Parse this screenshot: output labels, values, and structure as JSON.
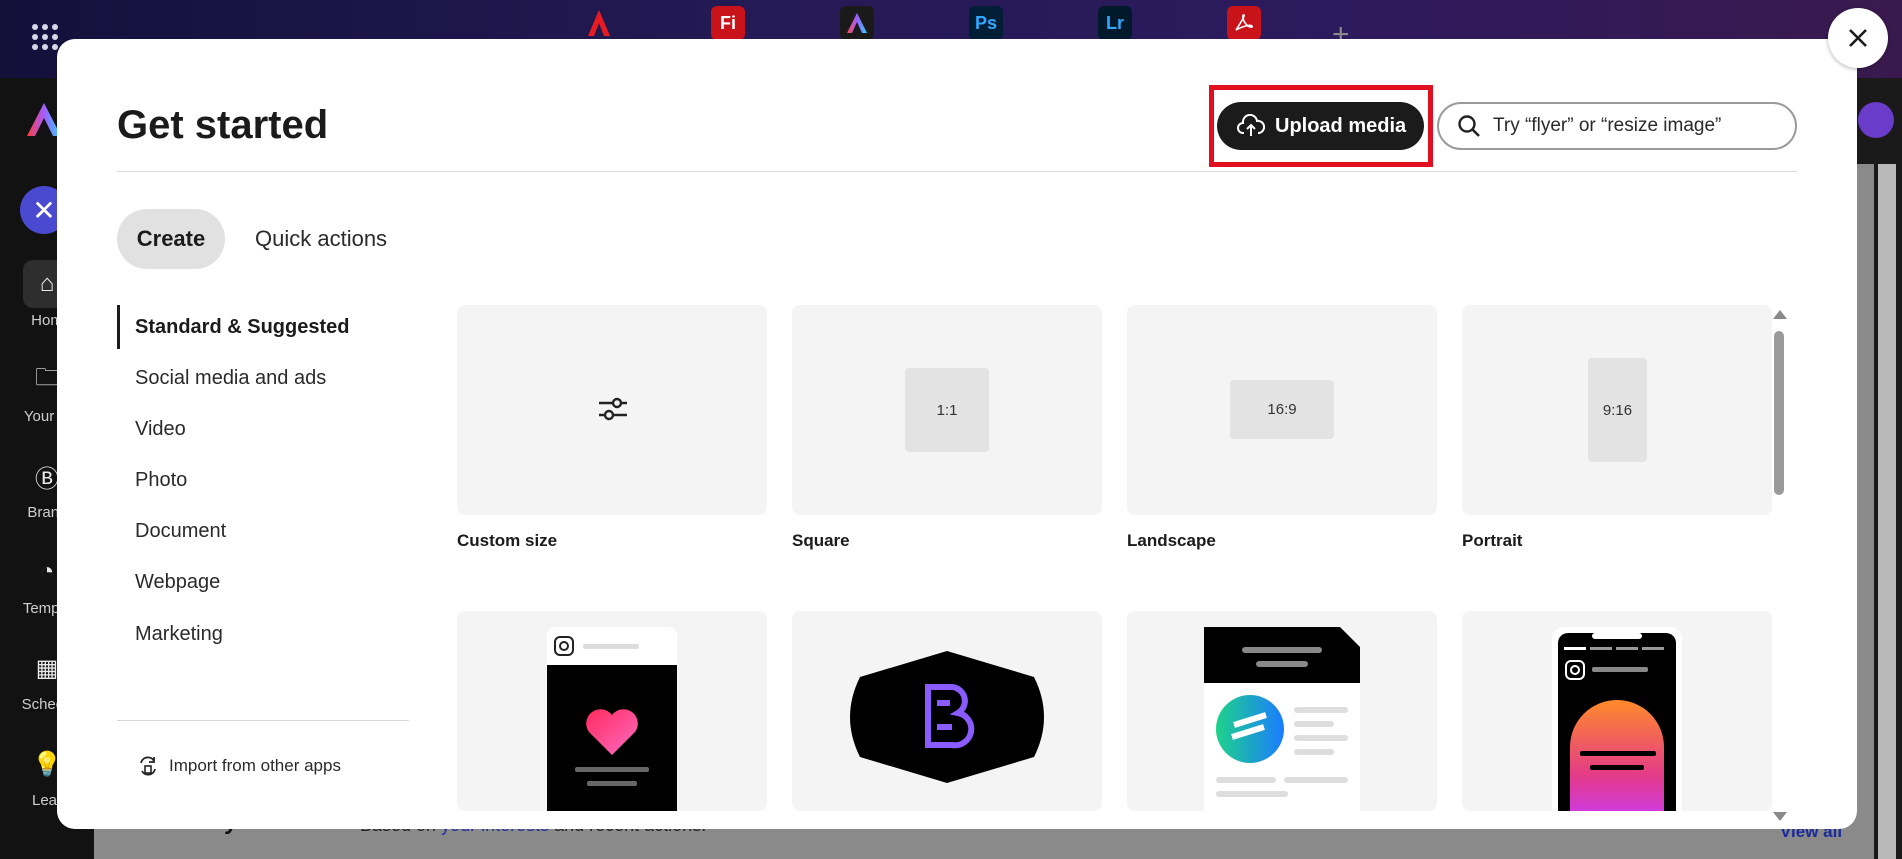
{
  "background": {
    "app_tabs": [
      {
        "label": "",
        "color": "#e81b23"
      },
      {
        "label": "Fi",
        "color": "#e81b23"
      },
      {
        "label": "",
        "color": "#2a2a2a"
      },
      {
        "label": "Ps",
        "color": "#001e36"
      },
      {
        "label": "Lr",
        "color": "#001a2c"
      },
      {
        "label": "",
        "color": "#e81b23"
      }
    ],
    "sidebar": {
      "items": [
        {
          "label": "Hom"
        },
        {
          "label": "Your st"
        },
        {
          "label": "Branc"
        },
        {
          "label": "Templa"
        },
        {
          "label": "Schedu"
        },
        {
          "label": "Lear"
        }
      ]
    },
    "more_ways": {
      "title": "More ways to start",
      "subtitle_pre": "Based on ",
      "subtitle_link": "your interests",
      "subtitle_post": " and recent actions.",
      "view_all": "View all"
    }
  },
  "dialog": {
    "title": "Get started",
    "upload_label": "Upload media",
    "search_placeholder": "Try “flyer” or “resize image”",
    "tabs": {
      "create": "Create",
      "quick_actions": "Quick actions"
    },
    "categories": [
      "Standard & Suggested",
      "Social media and ads",
      "Video",
      "Photo",
      "Document",
      "Webpage",
      "Marketing"
    ],
    "import_label": "Import from other apps",
    "cards": [
      {
        "label": "Custom size",
        "ratio": ""
      },
      {
        "label": "Square",
        "ratio": "1:1"
      },
      {
        "label": "Landscape",
        "ratio": "16:9"
      },
      {
        "label": "Portrait",
        "ratio": "9:16"
      }
    ],
    "highlight_color": "#e01020"
  }
}
